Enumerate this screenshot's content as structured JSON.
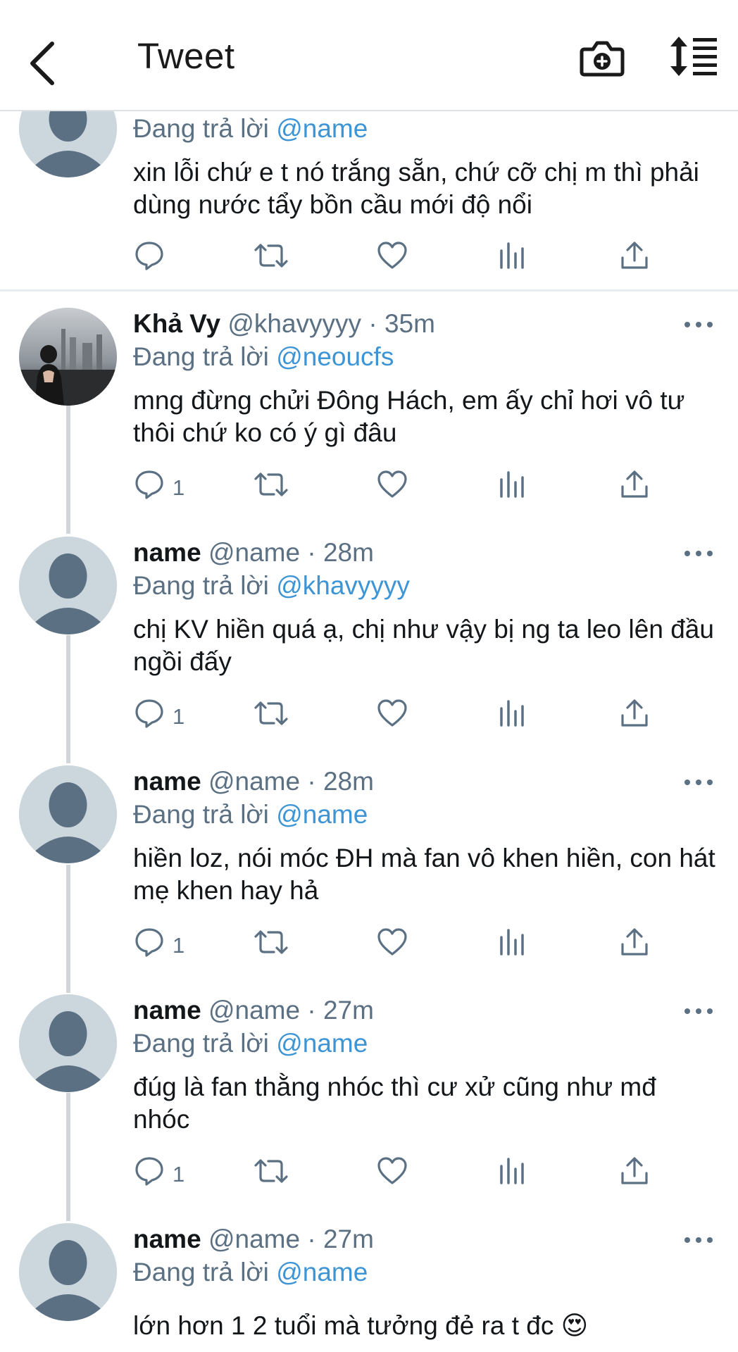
{
  "header": {
    "title": "Tweet",
    "back_icon": "chevron-left-icon",
    "camera_icon": "camera-plus-icon",
    "sort_icon": "sort-list-icon"
  },
  "colors": {
    "mention": "#3d95d5",
    "muted": "#5b7083",
    "avatar_bg": "#ccd6dd",
    "avatar_fg": "#5b7083",
    "thread_line": "#d0d6da"
  },
  "tweets": [
    {
      "name": "",
      "handle": "",
      "time": "",
      "reply_prefix": "Đang trả lời",
      "reply_to": "@name",
      "text": "xin lỗi chứ e t nó trắng sẵn, chứ cỡ chị m thì phải dùng nước tẩy bồn cầu mới độ nổi",
      "reply_count": ""
    },
    {
      "name": "Khả Vy",
      "handle": "@khavyyyy",
      "time": "· 35m",
      "reply_prefix": "Đang trả lời",
      "reply_to": "@neoucfs",
      "text": "mng đừng chửi Đông Hách, em ấy chỉ hơi vô tư thôi chứ ko có ý gì đâu",
      "reply_count": "1"
    },
    {
      "name": "name",
      "handle": "@name",
      "time": "· 28m",
      "reply_prefix": "Đang trả lời",
      "reply_to": "@khavyyyy",
      "text": "chị KV hiền quá ạ, chị như vậy bị ng ta leo lên đầu ngồi đấy",
      "reply_count": "1"
    },
    {
      "name": "name",
      "handle": "@name",
      "time": "· 28m",
      "reply_prefix": "Đang trả lời",
      "reply_to": "@name",
      "text": "hiền loz, nói móc ĐH mà fan vô khen hiền, con hát mẹ khen hay hả",
      "reply_count": "1"
    },
    {
      "name": "name",
      "handle": "@name",
      "time": "· 27m",
      "reply_prefix": "Đang trả lời",
      "reply_to": "@name",
      "text": "đúg là fan thằng nhóc thì cư xử cũng như mđ nhóc",
      "reply_count": "1"
    },
    {
      "name": "name",
      "handle": "@name",
      "time": "· 27m",
      "reply_prefix": "Đang trả lời",
      "reply_to": "@name",
      "text": "lớn hơn 1 2 tuổi mà tưởng đẻ ra t đc 😍",
      "reply_count": ""
    }
  ]
}
